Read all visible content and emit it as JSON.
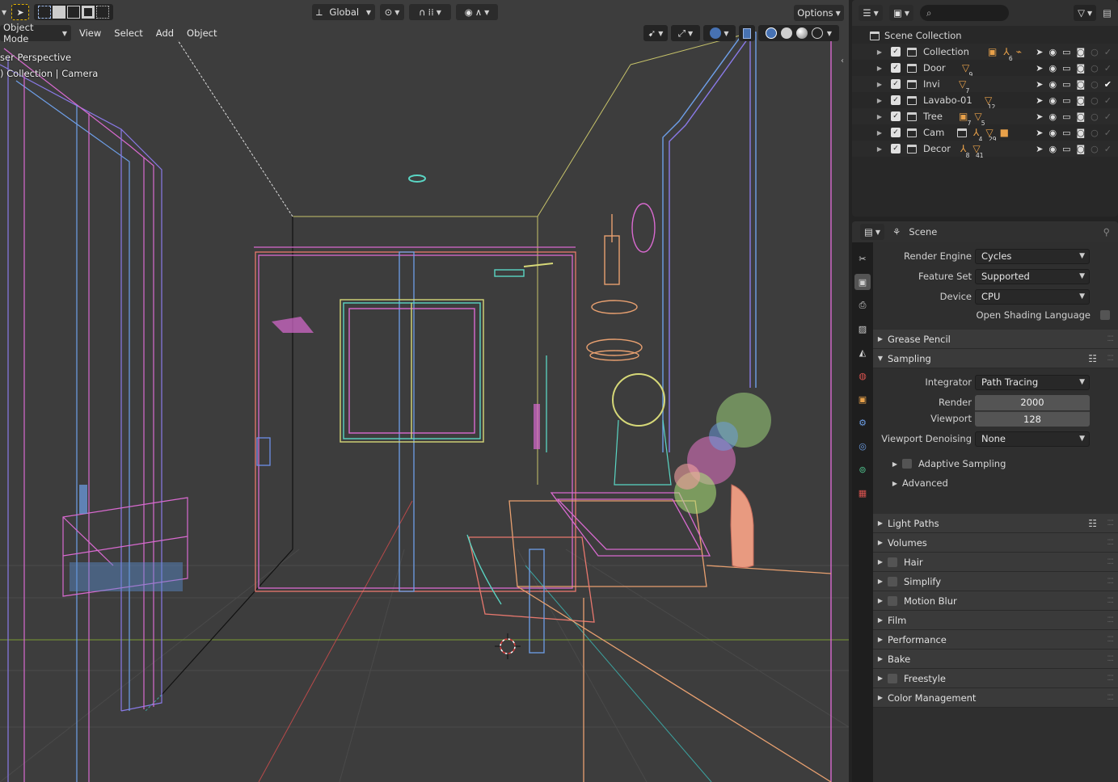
{
  "viewport": {
    "transform_orientation": "Global",
    "options_label": "Options",
    "mode": "Object Mode",
    "menu": [
      "View",
      "Select",
      "Add",
      "Object"
    ],
    "overlay_line1": "ser Perspective",
    "overlay_line2": ") Collection | Camera"
  },
  "outliner": {
    "root": "Scene Collection",
    "rows": [
      {
        "name": "Collection",
        "count": "6"
      },
      {
        "name": "Door",
        "count": "9"
      },
      {
        "name": "Invi",
        "count": "7"
      },
      {
        "name": "Lavabo-01",
        "count": "12"
      },
      {
        "name": "Tree",
        "count": "7",
        "count2": "5"
      },
      {
        "name": "Cam",
        "count": "4",
        "count2": "29"
      },
      {
        "name": "Decor",
        "count": "8",
        "count2": "41"
      }
    ]
  },
  "properties": {
    "context": "Scene",
    "render_engine_label": "Render Engine",
    "render_engine": "Cycles",
    "feature_set_label": "Feature Set",
    "feature_set": "Supported",
    "device_label": "Device",
    "device": "CPU",
    "osl_label": "Open Shading Language",
    "grease_pencil": "Grease Pencil",
    "sampling": "Sampling",
    "integrator_label": "Integrator",
    "integrator": "Path Tracing",
    "render_label": "Render",
    "render_samples": "2000",
    "viewport_label": "Viewport",
    "viewport_samples": "128",
    "denoise_label": "Viewport Denoising",
    "denoise": "None",
    "adaptive_sampling": "Adaptive Sampling",
    "advanced": "Advanced",
    "light_paths": "Light Paths",
    "volumes": "Volumes",
    "hair": "Hair",
    "simplify": "Simplify",
    "motion_blur": "Motion Blur",
    "film": "Film",
    "performance": "Performance",
    "bake": "Bake",
    "freestyle": "Freestyle",
    "color_management": "Color Management"
  },
  "colors": {
    "accent": "#4772b3",
    "object_orange": "#e8a14a"
  }
}
